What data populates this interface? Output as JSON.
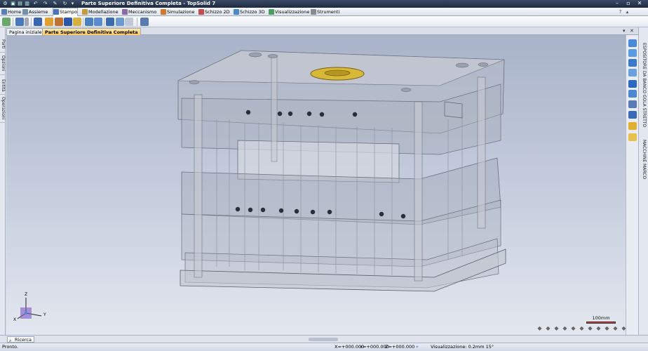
{
  "window": {
    "title": "Parte Superiore Definitiva Completa - TopSolid 7",
    "minimize_icon": "minimize-icon",
    "restore_icon": "restore-icon",
    "close_icon": "close-icon"
  },
  "menubar": {
    "items": [
      {
        "label": "Home",
        "icon": "home-icon",
        "color": "#5a7fb8"
      },
      {
        "label": "Assieme",
        "icon": "assembly-icon",
        "color": "#7a8fa8"
      },
      {
        "label": "Stampo",
        "icon": "mold-icon",
        "color": "#4a74c0",
        "active": true
      },
      {
        "label": "Modellazione",
        "icon": "modeling-icon",
        "color": "#c89a3a"
      },
      {
        "label": "Meccanismo",
        "icon": "mechanism-icon",
        "color": "#8a6aa8"
      },
      {
        "label": "Simulazione",
        "icon": "simulation-icon",
        "color": "#d07a2a"
      },
      {
        "label": "Schizzo 2D",
        "icon": "sketch-2d-icon",
        "color": "#c84a4a"
      },
      {
        "label": "Schizzo 3D",
        "icon": "sketch-3d-icon",
        "color": "#4a8ac8"
      },
      {
        "label": "Visualizzazione",
        "icon": "view-icon",
        "color": "#4aa05a"
      },
      {
        "label": "Strumenti",
        "icon": "tools-icon",
        "color": "#8a8a8a"
      }
    ]
  },
  "tabs": {
    "items": [
      {
        "label": "Pagina iniziale"
      },
      {
        "label": "Parte Superiore Definitiva Completa",
        "active": true
      }
    ]
  },
  "left_panels": [
    "Parti",
    "Opzioni",
    "Entità",
    "Operazioni"
  ],
  "right_panels": [
    "ESPOSITORE DA BANCO GOLA STRETTO",
    "MACCHINE MARCO"
  ],
  "scale": {
    "label": "100mm"
  },
  "search": {
    "label": "Ricerca"
  },
  "status": {
    "left": "Pronto.",
    "x": "X=+000.000",
    "y": "Y=+000.000",
    "z": "Z=+000.000",
    "view": "Visualizzazione: 0.2mm 15°"
  },
  "axes": {
    "x": "X",
    "y": "Y",
    "z": "Z"
  },
  "colors": {
    "accent": "#ffc95a",
    "titlebar": "#1e2a40",
    "viewport_top": "#a9b3c9"
  }
}
